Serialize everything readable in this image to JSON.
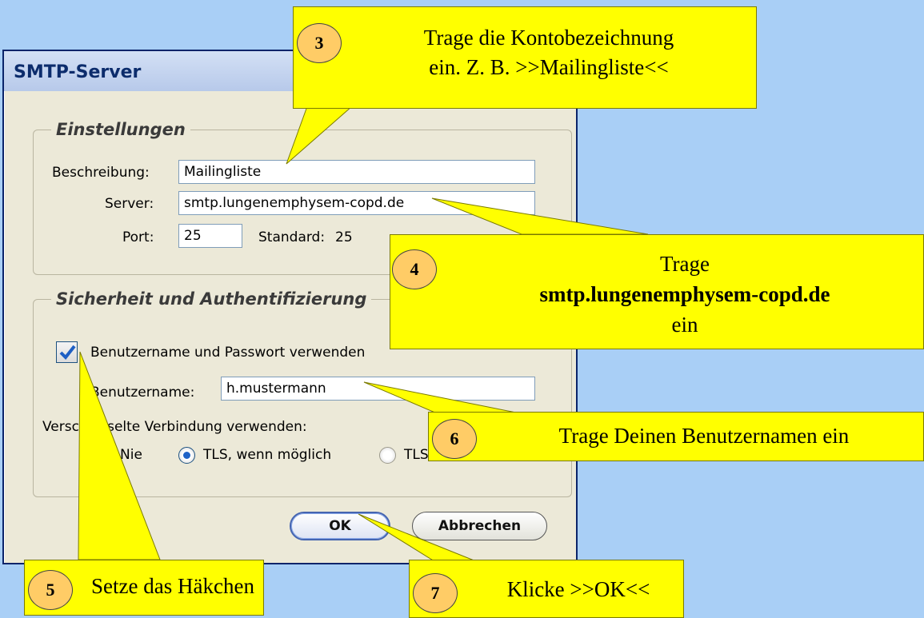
{
  "dialog": {
    "title": "SMTP-Server",
    "settings_group": "Einstellungen",
    "description_label": "Beschreibung:",
    "description_value": "Mailingliste",
    "server_label": "Server:",
    "server_value": "smtp.lungenemphysem-copd.de",
    "port_label": "Port:",
    "port_value": "25",
    "standard_label": "Standard:",
    "standard_value": "25",
    "security_group": "Sicherheit und Authentifizierung",
    "use_credentials_label": "Benutzername und Passwort verwenden",
    "use_credentials_checked": true,
    "username_label": "Benutzername:",
    "username_value": "h.mustermann",
    "encryption_label": "Verschlüsselte Verbindung verwenden:",
    "radio_never": "Nie",
    "radio_tls_if_possible": "TLS, wenn möglich",
    "radio_tls": "TLS",
    "selected_encryption": "TLS, wenn möglich",
    "ok_button": "OK",
    "cancel_button": "Abbrechen"
  },
  "callouts": {
    "step3": {
      "number": "3",
      "line1": "Trage die Kontobezeichnung",
      "line2": "ein. Z. B. >>Mailingliste<<"
    },
    "step4": {
      "number": "4",
      "line1": "Trage",
      "line2": "smtp.lungenemphysem-copd.de",
      "line3": "ein"
    },
    "step5": {
      "number": "5",
      "text": "Setze das Häkchen"
    },
    "step6": {
      "number": "6",
      "text": "Trage Deinen Benutzernamen ein"
    },
    "step7": {
      "number": "7",
      "text": "Klicke >>OK<<"
    }
  },
  "colors": {
    "background": "#a9cff6",
    "callout": "#ffff00",
    "number_badge": "#ffcc66",
    "dialog_face": "#ece9d8"
  }
}
